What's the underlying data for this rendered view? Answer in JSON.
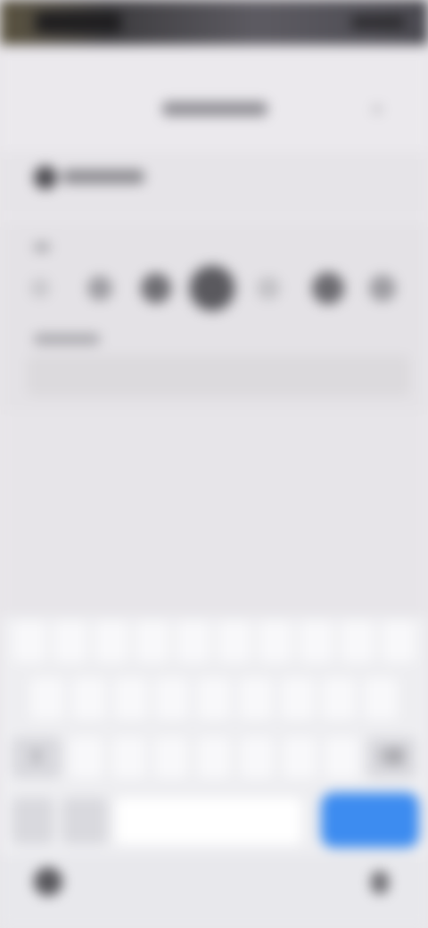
{
  "status_bar": {
    "time": "",
    "icons": [
      "signal-icon",
      "wifi-icon",
      "battery-icon"
    ]
  },
  "header": {
    "title": "",
    "close_icon": "close-icon"
  },
  "app": {
    "name": ""
  },
  "rating": {
    "label": "",
    "options": [
      {
        "icon": "rating-dot-icon"
      },
      {
        "icon": "rating-dot-icon"
      },
      {
        "icon": "rating-dot-icon"
      },
      {
        "icon": "rating-dot-icon",
        "selected": true
      },
      {
        "icon": "rating-dot-icon"
      },
      {
        "icon": "rating-dot-icon"
      },
      {
        "icon": "rating-dot-icon"
      }
    ]
  },
  "comment": {
    "label": "",
    "value": "",
    "placeholder": ""
  },
  "keyboard": {
    "row1": [
      "",
      "",
      "",
      "",
      "",
      "",
      "",
      "",
      "",
      ""
    ],
    "row2": [
      "",
      "",
      "",
      "",
      "",
      "",
      "",
      "",
      ""
    ],
    "row3": [
      "",
      "",
      "",
      "",
      "",
      "",
      ""
    ],
    "symbols_label": "",
    "emoji_label": "",
    "space_label": "",
    "enter_label": "",
    "enter_color": "#3d8cf0",
    "icons": [
      "shift-icon",
      "backspace-icon",
      "globe-icon",
      "mic-icon"
    ]
  }
}
